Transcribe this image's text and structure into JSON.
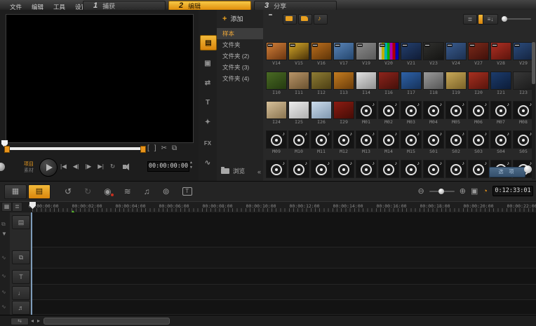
{
  "accent_color": "#e8941c",
  "menu_bar": {
    "items": [
      "文件",
      "编辑",
      "工具",
      "设置"
    ]
  },
  "steps": [
    {
      "num": "1",
      "label": "捕获",
      "active": false
    },
    {
      "num": "2",
      "label": "编辑",
      "active": true
    },
    {
      "num": "3",
      "label": "分享",
      "active": false
    }
  ],
  "preview": {
    "project_label": "项目",
    "clip_label": "素材",
    "time": "00:00:00:00",
    "trim_icons": [
      {
        "name": "mark-in-icon",
        "glyph": "["
      },
      {
        "name": "mark-out-icon",
        "glyph": "]"
      },
      {
        "name": "cut-clip-icon",
        "glyph": "✂"
      },
      {
        "name": "enlarge-preview-icon",
        "glyph": "⧉"
      }
    ],
    "transport": [
      {
        "name": "home-button",
        "glyph": "|◀"
      },
      {
        "name": "previous-frame-button",
        "glyph": "◀|"
      },
      {
        "name": "next-frame-button",
        "glyph": "|▶"
      },
      {
        "name": "end-button",
        "glyph": "▶|"
      },
      {
        "name": "repeat-button",
        "glyph": "↻"
      }
    ]
  },
  "library": {
    "strip": [
      {
        "name": "media-library-icon",
        "glyph": "▤",
        "active": true
      },
      {
        "name": "instant-project-icon",
        "glyph": "▣",
        "active": false
      },
      {
        "name": "transition-icon",
        "glyph": "⇄",
        "active": false
      },
      {
        "name": "title-icon",
        "glyph": "T",
        "active": false
      },
      {
        "name": "graphic-icon",
        "glyph": "✦",
        "active": false
      },
      {
        "name": "filter-icon",
        "glyph": "FX",
        "active": false
      },
      {
        "name": "path-icon",
        "glyph": "∿",
        "active": false
      }
    ],
    "add_label": "添加",
    "folders": [
      {
        "label": "样本",
        "selected": true
      },
      {
        "label": "文件夹",
        "selected": false
      },
      {
        "label": "文件夹 (2)",
        "selected": false
      },
      {
        "label": "文件夹 (3)",
        "selected": false
      },
      {
        "label": "文件夹 (4)",
        "selected": false
      }
    ],
    "browse_label": "浏览",
    "options_label": "选 项"
  },
  "gallery": {
    "rows": [
      {
        "cells": [
          {
            "l": "V14",
            "t": "v",
            "a": "#d4813a",
            "b": "#6a3510"
          },
          {
            "l": "V15",
            "t": "v",
            "a": "#d6a92a",
            "b": "#4a3208"
          },
          {
            "l": "V16",
            "t": "v",
            "a": "#bc6f1e",
            "b": "#5e3408"
          },
          {
            "l": "V17",
            "t": "v",
            "a": "#5a85b8",
            "b": "#24466e"
          },
          {
            "l": "V19",
            "t": "v",
            "a": "#8a8a8a",
            "b": "#5a5a5a"
          },
          {
            "l": "V20",
            "t": "test",
            "a": "#c0c0c0",
            "b": "#333333"
          },
          {
            "l": "V21",
            "t": "v",
            "a": "#24406e",
            "b": "#101c36"
          },
          {
            "l": "V23",
            "t": "v",
            "a": "#30302e",
            "b": "#151513"
          },
          {
            "l": "V24",
            "t": "v",
            "a": "#3a5c8e",
            "b": "#1c3050"
          },
          {
            "l": "V27",
            "t": "v",
            "a": "#7c2a1a",
            "b": "#40100a"
          },
          {
            "l": "V28",
            "t": "v",
            "a": "#b03024",
            "b": "#5c140c"
          },
          {
            "l": "V29",
            "t": "v",
            "a": "#2c4c7c",
            "b": "#142440"
          }
        ]
      },
      {
        "cells": [
          {
            "l": "I10",
            "t": "i",
            "a": "#4a6a24",
            "b": "#243a10"
          },
          {
            "l": "I11",
            "t": "i",
            "a": "#b89468",
            "b": "#6a5230"
          },
          {
            "l": "I12",
            "t": "i",
            "a": "#8e7c34",
            "b": "#4c3f14"
          },
          {
            "l": "I13",
            "t": "i",
            "a": "#c47c20",
            "b": "#6a3c0a"
          },
          {
            "l": "I14",
            "t": "i",
            "a": "#e0e0e0",
            "b": "#909090"
          },
          {
            "l": "I16",
            "t": "i",
            "a": "#8e241c",
            "b": "#44100a"
          },
          {
            "l": "I17",
            "t": "i",
            "a": "#2e62a8",
            "b": "#16325a"
          },
          {
            "l": "I18",
            "t": "i",
            "a": "#9a9a9a",
            "b": "#565656"
          },
          {
            "l": "I19",
            "t": "i",
            "a": "#c8a858",
            "b": "#7a6228"
          },
          {
            "l": "I20",
            "t": "i",
            "a": "#a83020",
            "b": "#58140c"
          },
          {
            "l": "I21",
            "t": "i",
            "a": "#1c3c6c",
            "b": "#0c1c38"
          },
          {
            "l": "I23",
            "t": "i",
            "a": "#383838",
            "b": "#1c1c1c"
          }
        ]
      },
      {
        "cells": [
          {
            "l": "I24",
            "t": "i",
            "a": "#d6c09a",
            "b": "#8a7450"
          },
          {
            "l": "I25",
            "t": "i",
            "a": "#ececec",
            "b": "#b0b0b0"
          },
          {
            "l": "I26",
            "t": "i",
            "a": "#ccdcec",
            "b": "#8098b0"
          },
          {
            "l": "I29",
            "t": "i",
            "a": "#8c1c12",
            "b": "#440c06"
          },
          {
            "l": "M01",
            "t": "a"
          },
          {
            "l": "M02",
            "t": "a"
          },
          {
            "l": "M03",
            "t": "a"
          },
          {
            "l": "M04",
            "t": "a"
          },
          {
            "l": "M05",
            "t": "a"
          },
          {
            "l": "M06",
            "t": "a"
          },
          {
            "l": "M07",
            "t": "a"
          },
          {
            "l": "M08",
            "t": "a"
          }
        ]
      },
      {
        "cells": [
          {
            "l": "M09",
            "t": "a"
          },
          {
            "l": "M10",
            "t": "a"
          },
          {
            "l": "M11",
            "t": "a"
          },
          {
            "l": "M12",
            "t": "a"
          },
          {
            "l": "M13",
            "t": "a"
          },
          {
            "l": "M14",
            "t": "a"
          },
          {
            "l": "M15",
            "t": "a"
          },
          {
            "l": "S01",
            "t": "a"
          },
          {
            "l": "S02",
            "t": "a"
          },
          {
            "l": "S03",
            "t": "a"
          },
          {
            "l": "S04",
            "t": "a"
          },
          {
            "l": "S05",
            "t": "a"
          }
        ]
      },
      {
        "cells": [
          {
            "l": "",
            "t": "a"
          },
          {
            "l": "",
            "t": "a"
          },
          {
            "l": "",
            "t": "a"
          },
          {
            "l": "",
            "t": "a"
          },
          {
            "l": "",
            "t": "a"
          },
          {
            "l": "",
            "t": "a"
          },
          {
            "l": "",
            "t": "a"
          },
          {
            "l": "",
            "t": "a"
          },
          {
            "l": "",
            "t": "a"
          },
          {
            "l": "",
            "t": "a"
          },
          {
            "l": "",
            "t": "a"
          },
          {
            "l": "",
            "t": "a"
          }
        ]
      }
    ]
  },
  "timeline": {
    "view_buttons": [
      {
        "name": "storyboard-view-button",
        "glyph": "▦",
        "active": false
      },
      {
        "name": "timeline-view-button",
        "glyph": "▤",
        "active": true
      }
    ],
    "toolbar_icons": [
      {
        "name": "undo-button",
        "glyph": "↺",
        "dim": false,
        "rec": false,
        "tbox": false
      },
      {
        "name": "redo-button",
        "glyph": "↻",
        "dim": true,
        "rec": false,
        "tbox": false
      },
      {
        "name": "record-capture-option-button",
        "glyph": "◉",
        "dim": false,
        "rec": true,
        "tbox": false
      },
      {
        "name": "sound-mixer-button",
        "glyph": "≋",
        "dim": false,
        "rec": false,
        "tbox": false
      },
      {
        "name": "auto-music-button",
        "glyph": "♫",
        "dim": false,
        "rec": false,
        "tbox": false
      },
      {
        "name": "painting-creator-button",
        "glyph": "⊚",
        "dim": false,
        "rec": false,
        "tbox": false
      },
      {
        "name": "subtitle-editor-button",
        "glyph": "T",
        "dim": false,
        "rec": false,
        "tbox": true
      }
    ],
    "project_duration": "0:12:33:01",
    "ruler_labels": [
      "00:00:00:00",
      "00:00:02:00",
      "00:00:04:00",
      "00:00:06:00",
      "00:00:08:00",
      "00:00:10:00",
      "00:00:12:00",
      "00:00:14:00",
      "00:00:16:00",
      "00:00:18:00",
      "00:00:20:00",
      "00:00:22:00"
    ],
    "tracks": [
      {
        "name": "video-track",
        "glyph": "▤",
        "side": "⧉",
        "h": 50
      },
      {
        "name": "overlay-track",
        "glyph": "⧉",
        "side": "∿",
        "h": 30
      },
      {
        "name": "title-track",
        "glyph": "T",
        "side": "∿",
        "h": 23
      },
      {
        "name": "voice-track",
        "glyph": "♩",
        "side": "∿",
        "h": 22
      },
      {
        "name": "music-track",
        "glyph": "♬",
        "side": "∿",
        "h": 21
      }
    ]
  }
}
